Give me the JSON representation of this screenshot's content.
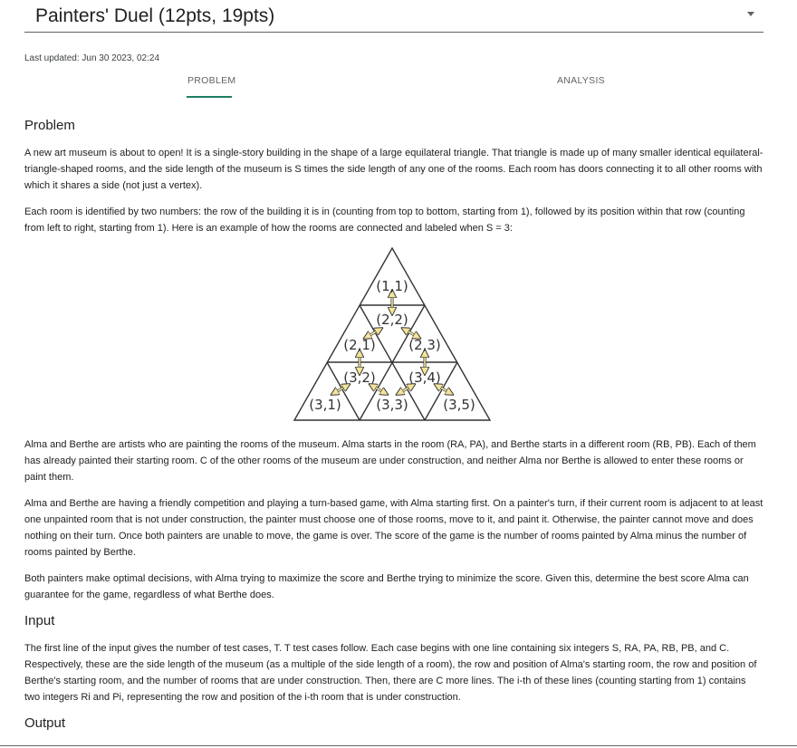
{
  "header": {
    "title": "Painters' Duel (12pts, 19pts)",
    "last_updated": "Last updated: Jun 30 2023, 02:24"
  },
  "tabs": [
    {
      "label": "PROBLEM",
      "active": true
    },
    {
      "label": "ANALYSIS",
      "active": false
    }
  ],
  "sections": {
    "problem_heading": "Problem",
    "input_heading": "Input",
    "output_heading": "Output"
  },
  "problem": {
    "p1": "A new art museum is about to open! It is a single-story building in the shape of a large equilateral triangle. That triangle is made up of many smaller identical equilateral-triangle-shaped rooms, and the side length of the museum is S times the side length of any one of the rooms. Each room has doors connecting it to all other rooms with which it shares a side (not just a vertex).",
    "p2": "Each room is identified by two numbers: the row of the building it is in (counting from top to bottom, starting from 1), followed by its position within that row (counting from left to right, starting from 1). Here is an example of how the rooms are connected and labeled when S = 3:",
    "p3": "Alma and Berthe are artists who are painting the rooms of the museum. Alma starts in the room (RA, PA), and Berthe starts in a different room (RB, PB). Each of them has already painted their starting room. C of the other rooms of the museum are under construction, and neither Alma nor Berthe is allowed to enter these rooms or paint them.",
    "p4": "Alma and Berthe are having a friendly competition and playing a turn-based game, with Alma starting first. On a painter's turn, if their current room is adjacent to at least one unpainted room that is not under construction, the painter must choose one of those rooms, move to it, and paint it. Otherwise, the painter cannot move and does nothing on their turn. Once both painters are unable to move, the game is over. The score of the game is the number of rooms painted by Alma minus the number of rooms painted by Berthe.",
    "p5": "Both painters make optimal decisions, with Alma trying to maximize the score and Berthe trying to minimize the score. Given this, determine the best score Alma can guarantee for the game, regardless of what Berthe does."
  },
  "input": {
    "p1": "The first line of the input gives the number of test cases, T. T test cases follow. Each case begins with one line containing six integers S, RA, PA, RB, PB, and C. Respectively, these are the side length of the museum (as a multiple of the side length of a room), the row and position of Alma's starting room, the row and position of Berthe's starting room, and the number of rooms that are under construction. Then, there are C more lines. The i-th of these lines (counting starting from 1) contains two integers Ri and Pi, representing the row and position of the i-th room that is under construction."
  },
  "figure": {
    "labels": [
      "(1,1)",
      "(2,1)",
      "(2,2)",
      "(2,3)",
      "(3,1)",
      "(3,2)",
      "(3,3)",
      "(3,4)",
      "(3,5)"
    ],
    "arrow_color": "#f3e49a"
  }
}
